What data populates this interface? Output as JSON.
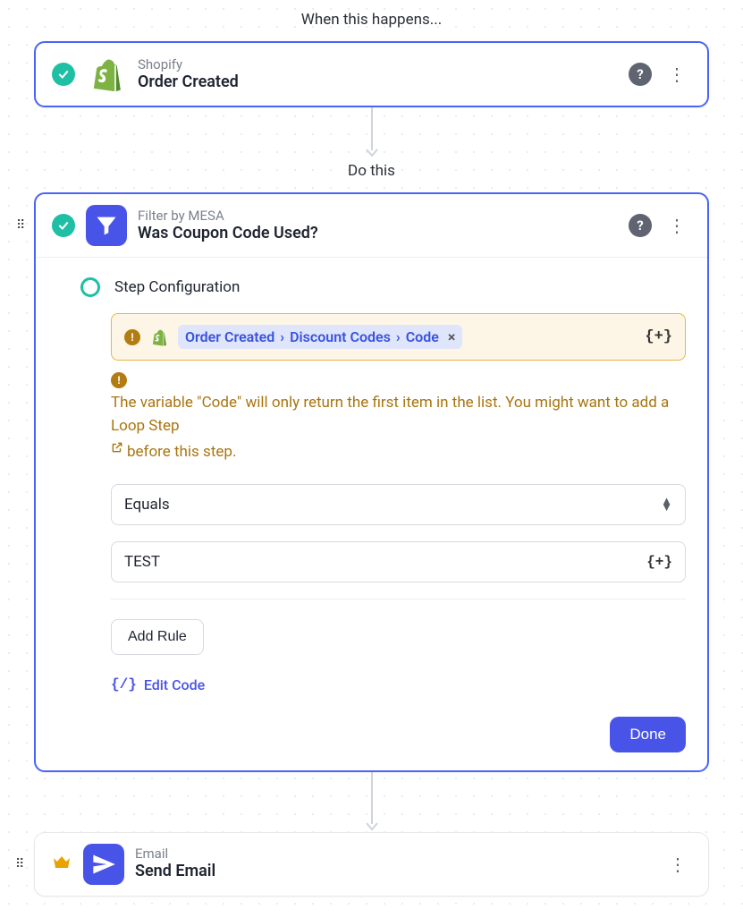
{
  "sections": {
    "trigger_label": "When this happens...",
    "action_label": "Do this"
  },
  "trigger": {
    "app": "Shopify",
    "title": "Order Created"
  },
  "filter": {
    "app": "Filter by MESA",
    "title": "Was Coupon Code Used?",
    "step_label": "Step Configuration",
    "variable": {
      "seg1": "Order Created",
      "seg2": "Discount Codes",
      "seg3": "Code"
    },
    "warning_text": "The variable \"Code\" will only return the first item in the list. You might want to add a Loop Step",
    "warning_text_after": "before this step.",
    "operator": "Equals",
    "value": "TEST",
    "add_rule_label": "Add Rule",
    "edit_code_label": "Edit Code",
    "done_label": "Done",
    "insert_var_symbol": "{+}"
  },
  "email": {
    "app": "Email",
    "title": "Send Email"
  }
}
